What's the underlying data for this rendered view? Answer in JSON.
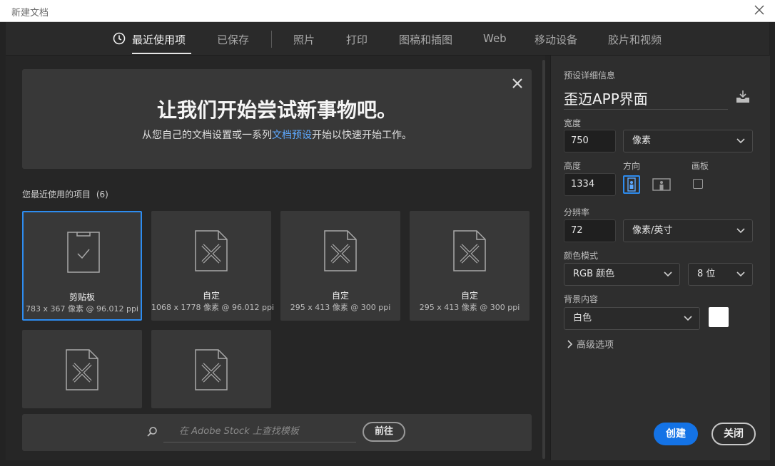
{
  "window": {
    "title": "新建文档"
  },
  "tabs": [
    {
      "label": "最近使用项"
    },
    {
      "label": "已保存"
    },
    {
      "label": "照片"
    },
    {
      "label": "打印"
    },
    {
      "label": "图稿和插图"
    },
    {
      "label": "Web"
    },
    {
      "label": "移动设备"
    },
    {
      "label": "胶片和视频"
    }
  ],
  "banner": {
    "headline": "让我们开始尝试新事物吧。",
    "sub_before": "从您自己的文档设置或一系列",
    "sub_link": "文档预设",
    "sub_after": "开始以快速开始工作。"
  },
  "recent": {
    "label": "您最近使用的项目",
    "count": "(6)",
    "items": [
      {
        "name": "剪贴板",
        "meta": "783 x 367 像素 @ 96.012 ppi",
        "icon": "clipboard-check-icon",
        "selected": true
      },
      {
        "name": "自定",
        "meta": "1068 x 1778 像素 @ 96.012 ppi",
        "icon": "document-ruler-pencil-icon"
      },
      {
        "name": "自定",
        "meta": "295 x 413 像素 @ 300 ppi",
        "icon": "document-ruler-pencil-icon"
      },
      {
        "name": "自定",
        "meta": "295 x 413 像素 @ 300 ppi",
        "icon": "document-ruler-pencil-icon"
      },
      {
        "name": "",
        "meta": "",
        "icon": "document-ruler-pencil-icon"
      },
      {
        "name": "",
        "meta": "",
        "icon": "document-ruler-pencil-icon"
      }
    ]
  },
  "stock": {
    "placeholder": "在 Adobe Stock 上查找模板",
    "go_label": "前往"
  },
  "details": {
    "section_title": "预设详细信息",
    "preset_name": "歪迈APP界面",
    "width_label": "宽度",
    "width_value": "750",
    "width_unit": "像素",
    "height_label": "高度",
    "height_value": "1334",
    "orientation_label": "方向",
    "artboard_label": "画板",
    "resolution_label": "分辨率",
    "resolution_value": "72",
    "resolution_unit": "像素/英寸",
    "color_mode_label": "颜色模式",
    "color_mode_value": "RGB 颜色",
    "bit_depth_value": "8 位",
    "background_label": "背景内容",
    "background_value": "白色",
    "background_swatch": "#ffffff",
    "advanced_label": "高级选项"
  },
  "actions": {
    "create_label": "创建",
    "close_label": "关闭"
  },
  "colors": {
    "accent": "#1473e6",
    "link": "#5ea9ff",
    "selected_border": "#2d8cf0"
  }
}
